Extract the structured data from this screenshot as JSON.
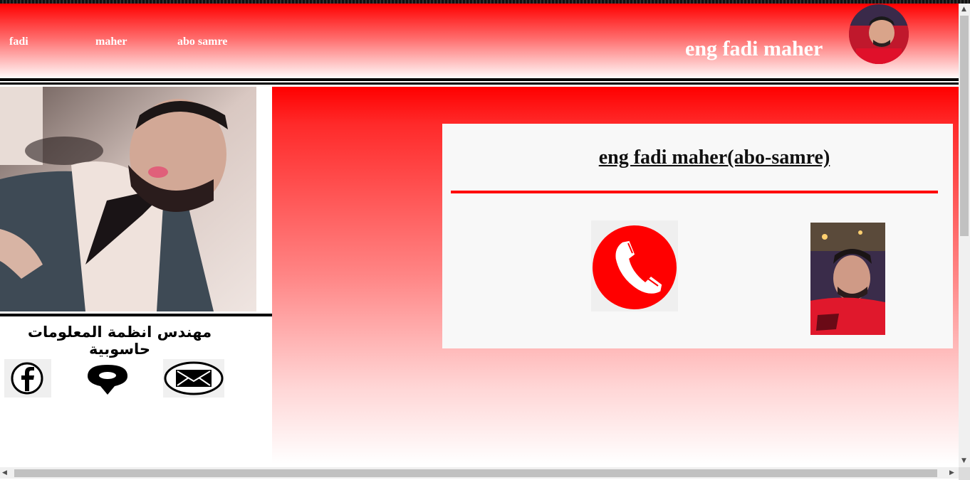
{
  "nav": {
    "items": [
      {
        "label": "fadi"
      },
      {
        "label": "maher"
      },
      {
        "label": "abo samre"
      }
    ]
  },
  "header": {
    "title": "eng fadi maher"
  },
  "sidebar": {
    "job_title": "مهندس انظمة المعلومات حاسوبية",
    "social": [
      {
        "icon": "facebook-icon"
      },
      {
        "icon": "location-pin-icon"
      },
      {
        "icon": "mail-icon"
      }
    ]
  },
  "card": {
    "title": "eng fadi maher(abo-samre)",
    "phone_icon": "phone-icon"
  },
  "colors": {
    "accent": "#ff0000",
    "card_bg": "#f8f8f8"
  }
}
